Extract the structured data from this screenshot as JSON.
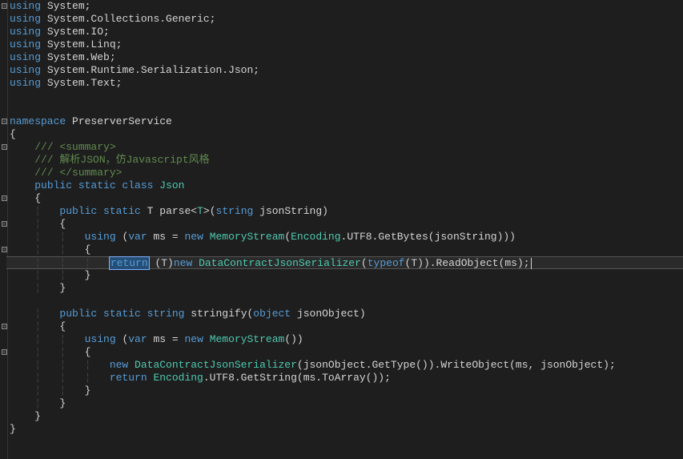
{
  "language": "csharp",
  "lines": [
    {
      "type": "using",
      "ns": "System"
    },
    {
      "type": "using",
      "ns": "System.Collections.Generic"
    },
    {
      "type": "using",
      "ns": "System.IO"
    },
    {
      "type": "using",
      "ns": "System.Linq"
    },
    {
      "type": "using",
      "ns": "System.Web"
    },
    {
      "type": "using",
      "ns": "System.Runtime.Serialization.Json"
    },
    {
      "type": "using",
      "ns": "System.Text"
    }
  ],
  "namespace_kw": "namespace",
  "namespace_name": "PreserverService",
  "summary_open": "/// <summary>",
  "summary_body": "/// 解析JSON，仿Javascript风格",
  "summary_close": "/// </summary>",
  "class_decl": {
    "mods": "public static class",
    "name": "Json"
  },
  "method_parse": {
    "mods": "public static",
    "ret": "T",
    "name": "parse<",
    "gen": "T",
    "close": ">(",
    "ptype": "string",
    "pname": "jsonString)"
  },
  "parse_using": {
    "u": "using",
    "open": " (",
    "v": "var",
    "ms": " ms = ",
    "n": "new",
    "ctor": "MemoryStream",
    "args": "(",
    "enc": "Encoding",
    ".UTF8.GetBytes(jsonString)))": true,
    "rest": ".UTF8.GetBytes(jsonString)))"
  },
  "parse_return": {
    "ret": "return",
    "cast": " (T)",
    "n": "new",
    "type": "DataContractJsonSerializer",
    "open": "(",
    "tf": "typeof",
    "t": "(T)).ReadObject(ms);"
  },
  "method_stringify": {
    "mods": "public static",
    "ret": "string",
    "name": "stringify(",
    "ptype": "object",
    "pname": "jsonObject)"
  },
  "stringify_using": {
    "u": "using",
    "open": " (",
    "v": "var",
    "ms": " ms = ",
    "n": "new",
    "ctor": "MemoryStream",
    "rest": "())"
  },
  "stringify_body1": {
    "n": "new",
    "type": "DataContractJsonSerializer",
    "rest": "(jsonObject.GetType()).WriteObject(ms, jsonObject);"
  },
  "stringify_body2": {
    "ret": "return",
    "enc": "Encoding",
    "rest": ".UTF8.GetString(ms.ToArray());"
  },
  "braces": {
    "open": "{",
    "close": "}"
  },
  "guides": {
    "i1": "    ",
    "i2": "        ",
    "i3": "            ",
    "i4": "                ",
    "i2g": "    ¦   ",
    "i3g": "    ¦   ¦   ",
    "i4g": "    ¦   ¦   ¦   "
  }
}
